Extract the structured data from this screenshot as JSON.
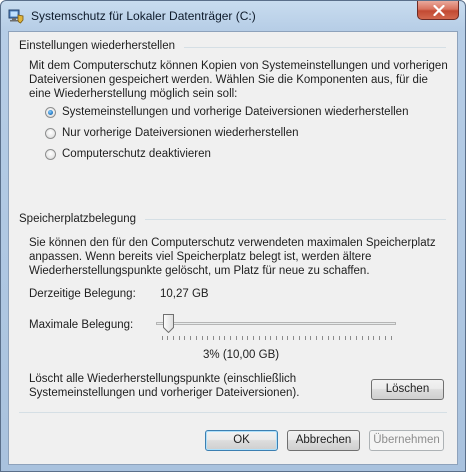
{
  "window": {
    "title": "Systemschutz für Lokaler Datenträger (C:)"
  },
  "restore_settings": {
    "header": "Einstellungen wiederherstellen",
    "description": "Mit dem Computerschutz können Kopien von Systemeinstellungen und vorherigen Dateiversionen gespeichert werden. Wählen Sie die Komponenten aus, für die eine Wiederherstellung möglich sein soll:",
    "options": [
      {
        "label": "Systemeinstellungen und vorherige Dateiversionen wiederherstellen",
        "selected": true
      },
      {
        "label": "Nur vorherige Dateiversionen wiederherstellen",
        "selected": false
      },
      {
        "label": "Computerschutz deaktivieren",
        "selected": false
      }
    ]
  },
  "disk_usage": {
    "header": "Speicherplatzbelegung",
    "description": "Sie können den für den Computerschutz verwendeten maximalen Speicherplatz anpassen. Wenn bereits viel Speicherplatz belegt ist, werden ältere Wiederherstellungspunkte gelöscht, um Platz für neue zu schaffen.",
    "current_label": "Derzeitige Belegung:",
    "current_value": "10,27 GB",
    "max_label": "Maximale Belegung:",
    "max_percent": 3,
    "max_readout": "3% (10,00 GB)",
    "delete_description": "Löscht alle Wiederherstellungspunkte (einschließlich Systemeinstellungen und vorheriger Dateiversionen).",
    "delete_button": "Löschen"
  },
  "buttons": {
    "ok": "OK",
    "cancel": "Abbrechen",
    "apply": "Übernehmen"
  },
  "icons": {
    "title": "system-protection-icon",
    "close": "close-icon"
  }
}
